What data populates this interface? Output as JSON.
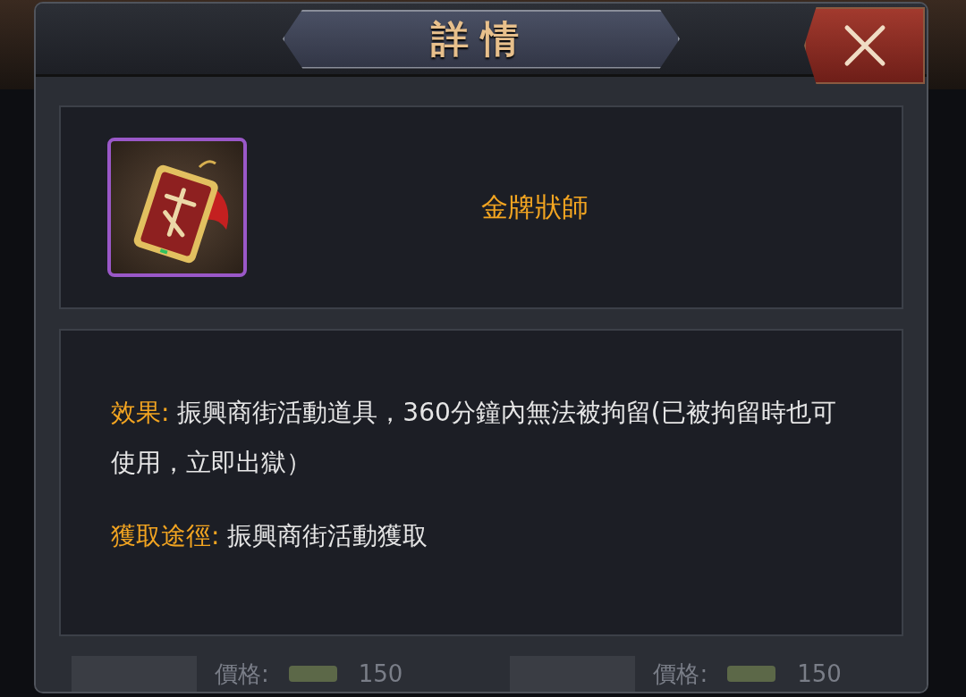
{
  "dialog": {
    "title": "詳情"
  },
  "item": {
    "name": "金牌狀師"
  },
  "details": [
    {
      "label": "效果:",
      "text": "振興商街活動道具，360分鐘內無法被拘留(已被拘留時也可使用，立即出獄）"
    },
    {
      "label": "獲取途徑:",
      "text": "振興商街活動獲取"
    }
  ],
  "background_shop": [
    {
      "price_label": "價格:",
      "price": "150"
    },
    {
      "price_label": "價格:",
      "price": "150"
    }
  ]
}
